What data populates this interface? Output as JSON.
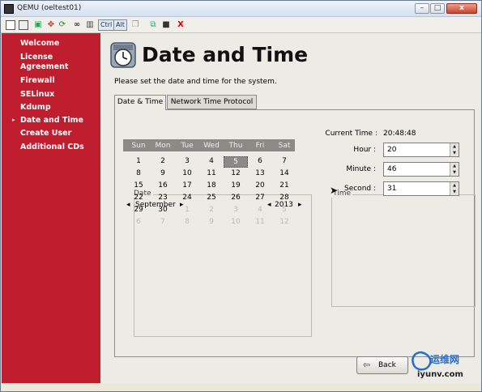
{
  "window": {
    "title": "QEMU (oeltest01)",
    "min": "–",
    "max": "□",
    "close": "x"
  },
  "toolbar": {
    "ctrl": "Ctrl",
    "alt": "Alt",
    "close_glyph": "X"
  },
  "sidebar": {
    "items": [
      {
        "label": "Welcome"
      },
      {
        "label": "License\nAgreement"
      },
      {
        "label": "Firewall"
      },
      {
        "label": "SELinux"
      },
      {
        "label": "Kdump"
      },
      {
        "label": "Date and Time",
        "current": true
      },
      {
        "label": "Create User"
      },
      {
        "label": "Additional CDs"
      }
    ],
    "arrow": "▸"
  },
  "header": {
    "title": "Date and Time"
  },
  "instructions": "Please set the date and time for the system.",
  "tabs": [
    {
      "label": "Date & Time",
      "active": true
    },
    {
      "label": "Network Time Protocol",
      "active": false
    }
  ],
  "date": {
    "section_label": "Date",
    "month": "September",
    "year": "2013",
    "prev": "◂",
    "next": "▸",
    "weekdays": [
      "Sun",
      "Mon",
      "Tue",
      "Wed",
      "Thu",
      "Fri",
      "Sat"
    ],
    "weeks": [
      [
        "1",
        "2",
        "3",
        "4",
        "5",
        "6",
        "7"
      ],
      [
        "8",
        "9",
        "10",
        "11",
        "12",
        "13",
        "14"
      ],
      [
        "15",
        "16",
        "17",
        "18",
        "19",
        "20",
        "21"
      ],
      [
        "22",
        "23",
        "24",
        "25",
        "26",
        "27",
        "28"
      ],
      [
        "29",
        "30",
        "1",
        "2",
        "3",
        "4",
        "5"
      ],
      [
        "6",
        "7",
        "8",
        "9",
        "10",
        "11",
        "12"
      ]
    ],
    "selected_day": "5"
  },
  "time": {
    "section_label": "Time",
    "current_label": "Current Time :",
    "current_value": "20:48:48",
    "hour_label": "Hour :",
    "hour_value": "20",
    "minute_label": "Minute :",
    "minute_value": "46",
    "second_label": "Second :",
    "second_value": "31"
  },
  "buttons": {
    "back": "Back"
  },
  "watermark": {
    "line1": "运维网",
    "line2": "iyunv.com"
  },
  "colors": {
    "sidebar": "#bf1e2e",
    "selected_day": "#8c8a86"
  }
}
